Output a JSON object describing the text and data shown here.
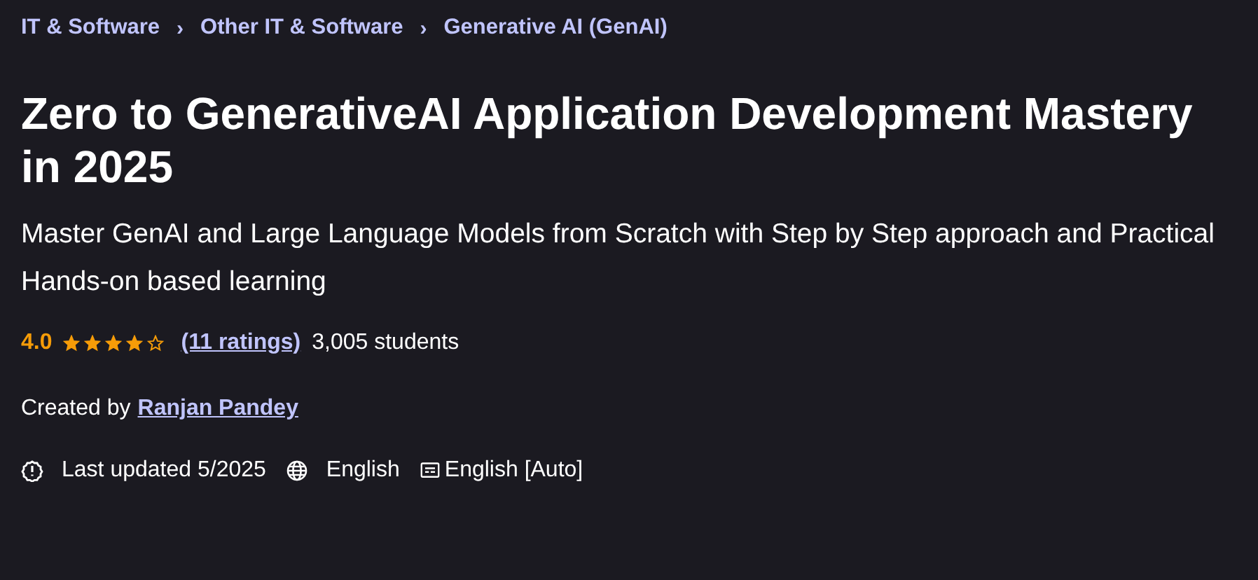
{
  "breadcrumbs": [
    {
      "label": "IT & Software"
    },
    {
      "label": "Other IT & Software"
    },
    {
      "label": "Generative AI (GenAI)"
    }
  ],
  "separator": "›",
  "title": "Zero to GenerativeAI Application Development Mastery in 2025",
  "subtitle": "Master GenAI and Large Language Models from Scratch with Step by Step approach and Practical Hands-on based learning",
  "rating": {
    "score": "4.0",
    "stars": 4,
    "ratings_link": "(11 ratings)",
    "students": "3,005 students"
  },
  "creator": {
    "prefix": "Created by",
    "name": "Ranjan Pandey"
  },
  "meta": {
    "updated": "Last updated 5/2025",
    "language": "English",
    "captions": "English [Auto]"
  }
}
